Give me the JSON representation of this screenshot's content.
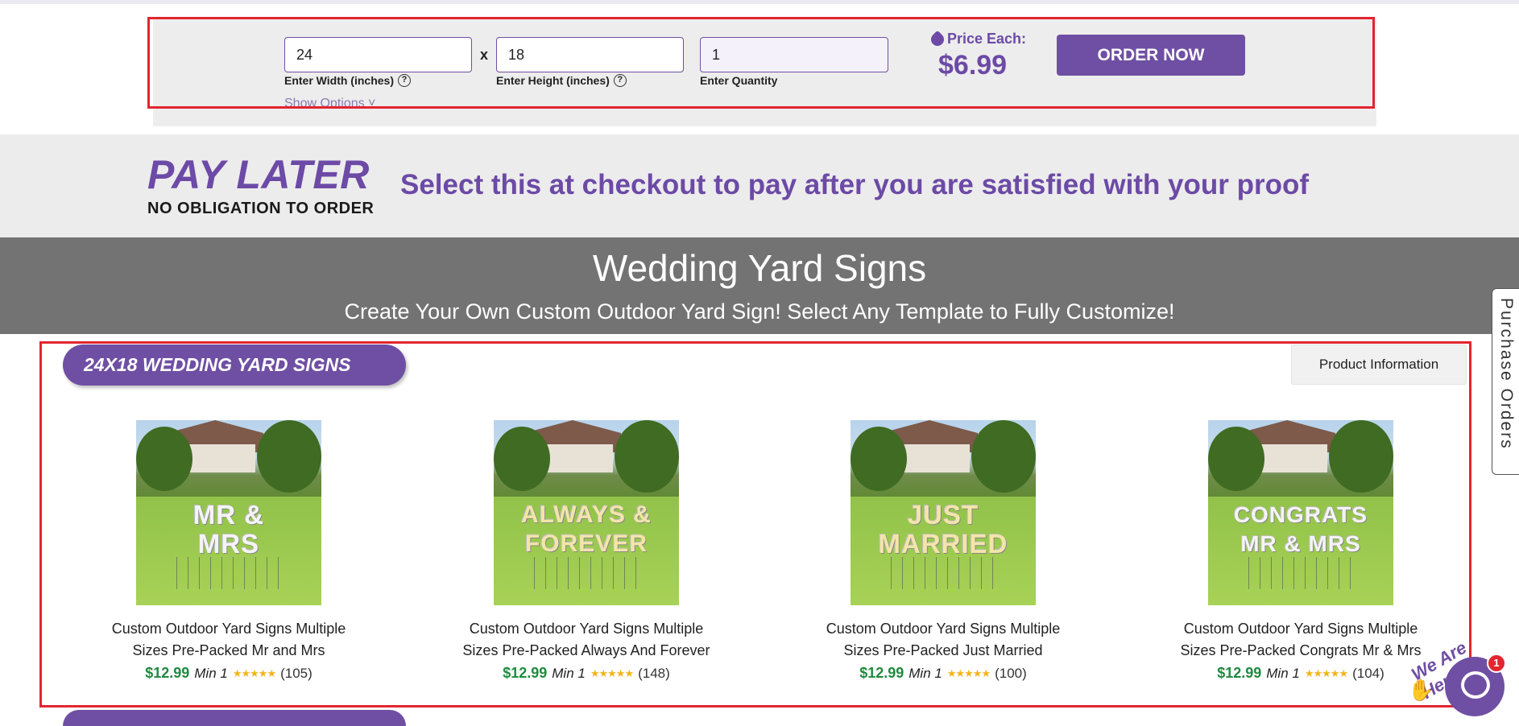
{
  "order_bar": {
    "width_value": "24",
    "width_label": "Enter Width (inches)",
    "separator": "x",
    "height_value": "18",
    "height_label": "Enter Height (inches)",
    "quantity_value": "1",
    "quantity_label": "Enter Quantity",
    "help_glyph": "?",
    "show_options": "Show Options ˅",
    "price_label": "Price Each:",
    "price_value": "$6.99",
    "order_button": "ORDER NOW"
  },
  "pay_later": {
    "title": "PAY LATER",
    "subtitle": "NO OBLIGATION TO ORDER",
    "description": "Select this at checkout to pay after you are satisfied with your proof"
  },
  "header": {
    "title": "Wedding Yard Signs",
    "subtitle": "Create Your Own Custom Outdoor Yard Sign! Select Any Template to Fully Customize!"
  },
  "section": {
    "title": "24X18 WEDDING YARD SIGNS",
    "product_info_button": "Product Information"
  },
  "products": [
    {
      "sign_line1": "MR &",
      "sign_line2": "MRS",
      "title_line1": "Custom Outdoor Yard Signs Multiple",
      "title_line2": "Sizes Pre-Packed Mr and Mrs",
      "price": "$12.99",
      "min": "Min 1",
      "stars": "★★★★★",
      "reviews": "(105)"
    },
    {
      "sign_line1": "ALWAYS &",
      "sign_line2": "FOREVER",
      "title_line1": "Custom Outdoor Yard Signs Multiple",
      "title_line2": "Sizes Pre-Packed Always And Forever",
      "price": "$12.99",
      "min": "Min 1",
      "stars": "★★★★★",
      "reviews": "(148)"
    },
    {
      "sign_line1": "JUST",
      "sign_line2": "MARRIED",
      "title_line1": "Custom Outdoor Yard Signs Multiple",
      "title_line2": "Sizes Pre-Packed Just Married",
      "price": "$12.99",
      "min": "Min 1",
      "stars": "★★★★★",
      "reviews": "(100)"
    },
    {
      "sign_line1": "CONGRATS",
      "sign_line2": "MR & MRS",
      "title_line1": "Custom Outdoor Yard Signs Multiple",
      "title_line2": "Sizes Pre-Packed Congrats Mr & Mrs",
      "price": "$12.99",
      "min": "Min 1",
      "stars": "★★★★★",
      "reviews": "(104)"
    }
  ],
  "side_tab": {
    "label": "Purchase Orders"
  },
  "chat": {
    "badge_count": "1",
    "tagline": "We Are Here!"
  },
  "colors": {
    "brand_purple": "#6f4fa3",
    "price_green": "#1f8a3f",
    "highlight_red": "#e2252f",
    "header_gray": "#737373"
  }
}
